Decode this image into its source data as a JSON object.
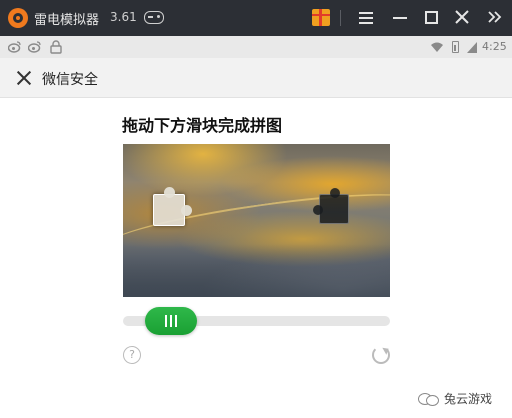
{
  "window": {
    "app_name": "雷电模拟器",
    "version": "3.61",
    "icons": [
      "app-logo",
      "gamepad-icon",
      "gift-icon",
      "menu-icon",
      "minimize-icon",
      "maximize-icon",
      "close-icon",
      "collapse-icon"
    ]
  },
  "status_bar": {
    "time": "4:25",
    "left_icons": [
      "weibo-icon",
      "weibo-icon",
      "lock-icon"
    ],
    "right_icons": [
      "wifi-icon",
      "battery-icon",
      "signal-icon"
    ]
  },
  "wechat_header": {
    "title": "微信安全",
    "close_icon": "close-icon"
  },
  "captcha": {
    "instruction": "拖动下方滑块完成拼图",
    "slider_progress": 0.08,
    "help_icon_glyph": "?",
    "refresh_icon": "refresh-icon"
  },
  "watermark": {
    "text": "兔云游戏"
  },
  "colors": {
    "titlebar_bg": "#2c2f35",
    "logo_orange": "#f07a1e",
    "slider_green": "#1aa033",
    "track_gray": "#e5e5e5"
  }
}
